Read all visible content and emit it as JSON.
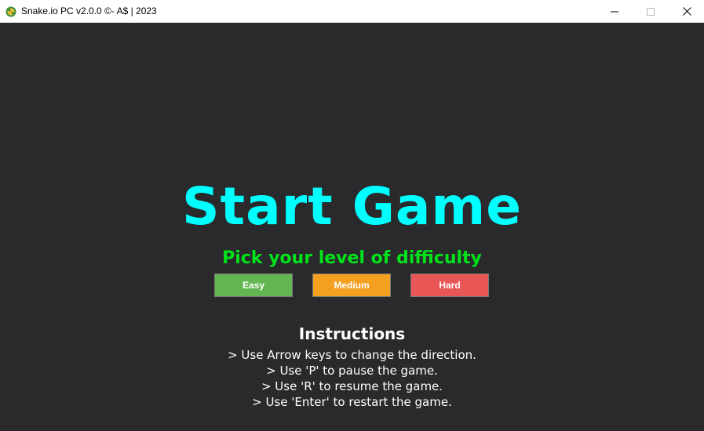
{
  "window": {
    "title": "Snake.io PC v2.0.0 ©- A$ | 2023",
    "icon": "snake-app-icon",
    "controls": [
      "minimize-icon",
      "maximize-icon",
      "close-icon"
    ]
  },
  "game": {
    "background": "#2a2a2c",
    "start_title": "Start Game",
    "start_title_color": "#00ffff",
    "difficulty_prompt": "Pick your level of difficulty",
    "difficulty_prompt_color": "#00e21a",
    "difficulties": [
      {
        "label": "Easy",
        "color": "#63b651"
      },
      {
        "label": "Medium",
        "color": "#f4a020"
      },
      {
        "label": "Hard",
        "color": "#e95656"
      }
    ],
    "instructions_title": "Instructions",
    "instructions": [
      "> Use Arrow keys to change the direction.",
      "> Use 'P' to pause the game.",
      "> Use 'R' to resume the game.",
      "> Use 'Enter' to restart the game."
    ]
  }
}
